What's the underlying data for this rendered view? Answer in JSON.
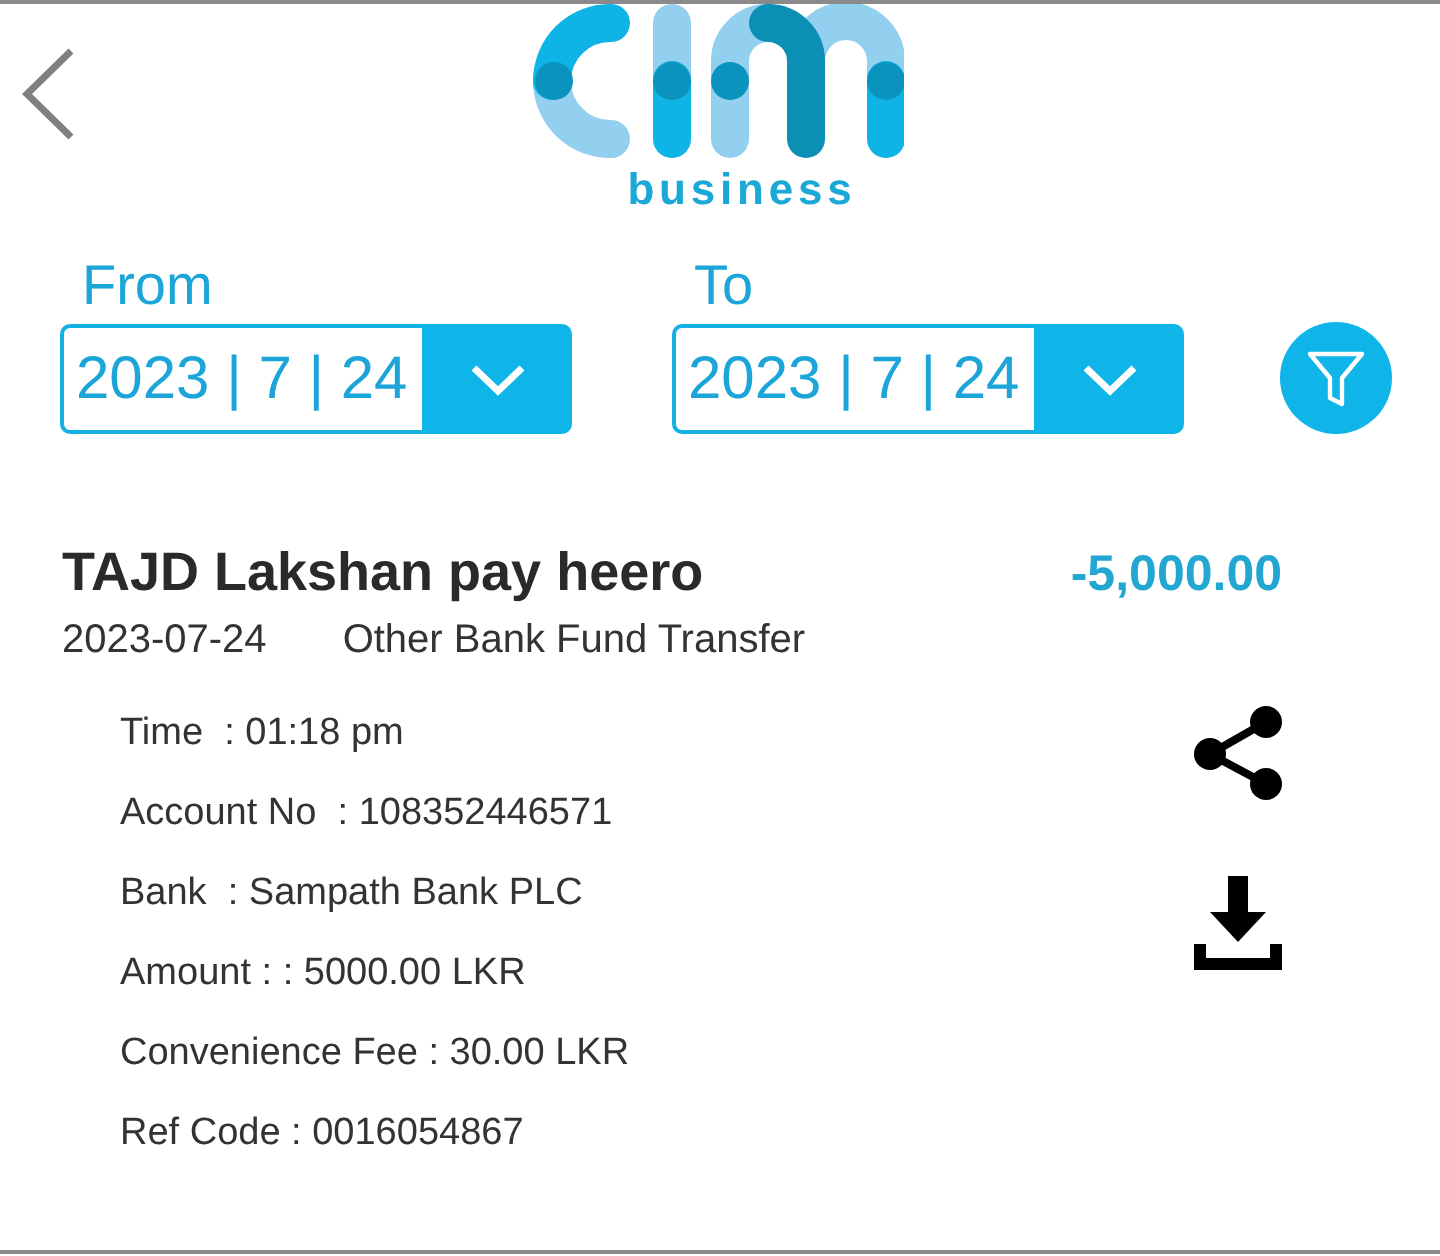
{
  "header": {
    "logo_caption": "business"
  },
  "date_filters": [
    {
      "label": "From",
      "value": "2023 | 7 | 24"
    },
    {
      "label": "To",
      "value": "2023 | 7 | 24"
    }
  ],
  "transaction": {
    "title": "TAJD Lakshan pay heero",
    "amount": "-5,000.00",
    "date": "2023-07-24",
    "type": "Other Bank Fund Transfer",
    "details": [
      "Time  : 01:18 pm",
      "Account No  : 108352446571",
      "Bank  : Sampath Bank PLC",
      "Amount : : 5000.00 LKR",
      "Convenience Fee : 30.00 LKR",
      "Ref Code : 0016054867"
    ]
  }
}
